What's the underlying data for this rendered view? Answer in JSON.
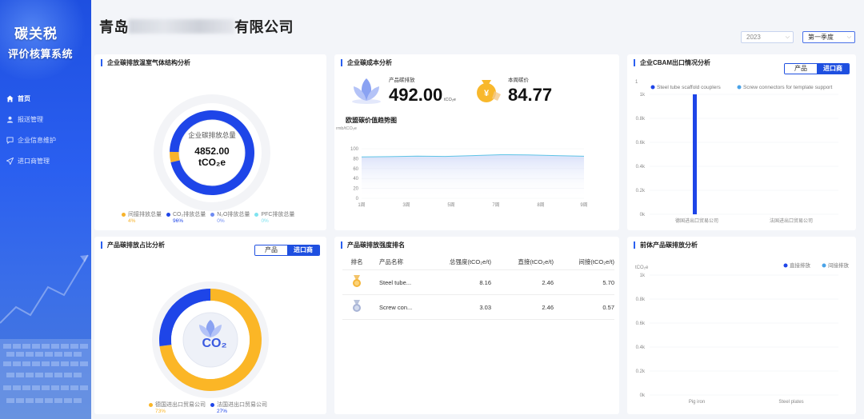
{
  "sidebar": {
    "brand_line1": "碳关税",
    "brand_line2": "评价核算系统",
    "items": [
      {
        "label": "首页"
      },
      {
        "label": "报送管理"
      },
      {
        "label": "企业信息维护"
      },
      {
        "label": "进口商管理"
      }
    ]
  },
  "header": {
    "title_prefix": "青岛",
    "title_suffix": "有限公司",
    "year_select": "2023",
    "quarter_select": "第一季度"
  },
  "ghg_card": {
    "title": "企业碳排放温室气体结构分析",
    "center_label": "企业碳排放总量",
    "center_value": "4852.00",
    "center_unit": "tCO₂e",
    "legend": [
      {
        "label": "间接排放总量",
        "pct": "4%",
        "color": "#f7b32b"
      },
      {
        "label": "CO₂排放总量",
        "pct": "96%",
        "color": "#1e45e8"
      },
      {
        "label": "N₂O排放总量",
        "pct": "0%",
        "color": "#6d8bf2"
      },
      {
        "label": "PFC排放总量",
        "pct": "0%",
        "color": "#7fe3f0"
      }
    ],
    "values": [
      4,
      96
    ]
  },
  "cost_card": {
    "title": "企业碳成本分析",
    "emission_label": "产品碳排放",
    "emission_value": "492.00",
    "emission_unit": "tCO₂e",
    "price_label": "本周碳价",
    "price_value": "84.77",
    "trend_title": "欧盟碳价值趋势图",
    "trend_unit": "rmb/tCO₂e"
  },
  "cbam_card": {
    "title": "企业CBAM出口情况分析",
    "toggle_product": "产品",
    "toggle_importer": "进口商",
    "top_label": "1"
  },
  "share_card": {
    "title": "产品碳排放占比分析",
    "toggle_product": "产品",
    "toggle_importer": "进口商",
    "badge": "CO₂",
    "legend": [
      {
        "label": "德国进出口贸易公司",
        "pct": "73%",
        "color": "#fbb626"
      },
      {
        "label": "法国进出口贸易公司",
        "pct": "27%",
        "color": "#1e45e8"
      }
    ],
    "values": [
      73,
      27
    ]
  },
  "rank_card": {
    "title": "产品碳排放强度排名",
    "headers": [
      "排名",
      "产品名称",
      "总强度(tCO₂e/t)",
      "直接(tCO₂e/t)",
      "间接(tCO₂e/t)"
    ],
    "rows": [
      {
        "name": "Steel tube...",
        "total": "8.16",
        "direct": "2.46",
        "indirect": "5.70"
      },
      {
        "name": "Screw con...",
        "total": "3.03",
        "direct": "2.46",
        "indirect": "0.57"
      }
    ]
  },
  "precursor_card": {
    "title": "前体产品碳排放分析",
    "unit": "tCO₂e"
  },
  "chart_data": [
    {
      "type": "line",
      "x": [
        "1周",
        "2周",
        "3周",
        "4周",
        "5周",
        "6周",
        "7周",
        "8周",
        "9周"
      ],
      "x_ticks": [
        "1周",
        "3周",
        "5周",
        "7周",
        "8周",
        "9周"
      ],
      "series": [
        {
          "values": [
            83.5,
            84,
            85,
            84.5,
            86,
            88,
            87.5,
            86,
            84.8
          ]
        }
      ],
      "ylabel": "rmb/tCO₂e",
      "ylim": [
        0,
        100
      ],
      "yticks": [
        "0",
        "20",
        "40",
        "60",
        "80",
        "100"
      ],
      "color": "#5fc4e6"
    },
    {
      "type": "bar",
      "categories": [
        "德国进出口贸易公司",
        "法国进出口贸易公司"
      ],
      "series": [
        {
          "name": "Steel tube scaffold couplers",
          "values": [
            1000,
            0
          ]
        },
        {
          "name": "Screw connectors for template support",
          "values": [
            0,
            0
          ]
        }
      ],
      "ylim": [
        0,
        1000
      ],
      "yticks": [
        "0k",
        "0.2k",
        "0.4k",
        "0.6k",
        "0.8k",
        "1k"
      ],
      "colors": [
        "#1e45e8",
        "#4aa3e8"
      ]
    },
    {
      "type": "bar",
      "categories": [
        "Pig iron",
        "Steel plates"
      ],
      "series": [
        {
          "name": "直接排放",
          "values": [
            0,
            0
          ]
        },
        {
          "name": "间接排放",
          "values": [
            0,
            0
          ]
        }
      ],
      "ylim": [
        0,
        1000
      ],
      "yticks": [
        "0k",
        "0.2k",
        "0.4k",
        "0.6k",
        "0.8k",
        "1k"
      ],
      "ylabel": "tCO₂e",
      "colors": [
        "#1e45e8",
        "#4aa3e8"
      ]
    }
  ]
}
